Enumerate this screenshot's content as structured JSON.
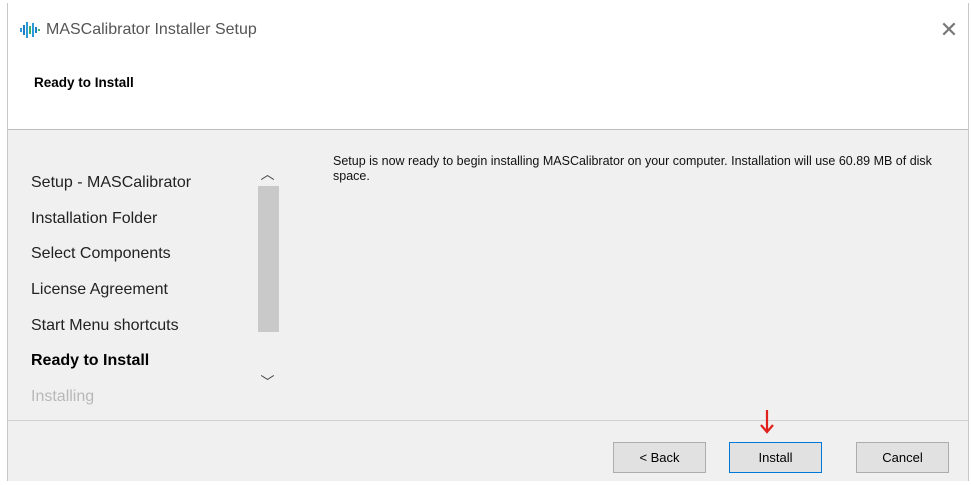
{
  "window": {
    "title": "MASCalibrator Installer Setup",
    "app_icon": "waveform-app-icon",
    "close_icon": "close-icon"
  },
  "header": {
    "title": "Ready to Install"
  },
  "sidebar": {
    "items": [
      {
        "label": "Setup - MASCalibrator",
        "state": "normal"
      },
      {
        "label": "Installation Folder",
        "state": "normal"
      },
      {
        "label": "Select Components",
        "state": "normal"
      },
      {
        "label": "License Agreement",
        "state": "normal"
      },
      {
        "label": "Start Menu shortcuts",
        "state": "normal"
      },
      {
        "label": "Ready to Install",
        "state": "active"
      },
      {
        "label": "Installing",
        "state": "faded"
      }
    ],
    "scroll_up_icon": "chevron-up-icon",
    "scroll_down_icon": "chevron-down-icon"
  },
  "main": {
    "message": "Setup is now ready to begin installing MASCalibrator on your computer. Installation will use 60.89 MB of disk space."
  },
  "footer": {
    "back_label": "< Back",
    "install_label": "Install",
    "cancel_label": "Cancel"
  },
  "annotation": {
    "arrow_icon": "red-down-arrow-icon",
    "color": "#e0201b"
  }
}
